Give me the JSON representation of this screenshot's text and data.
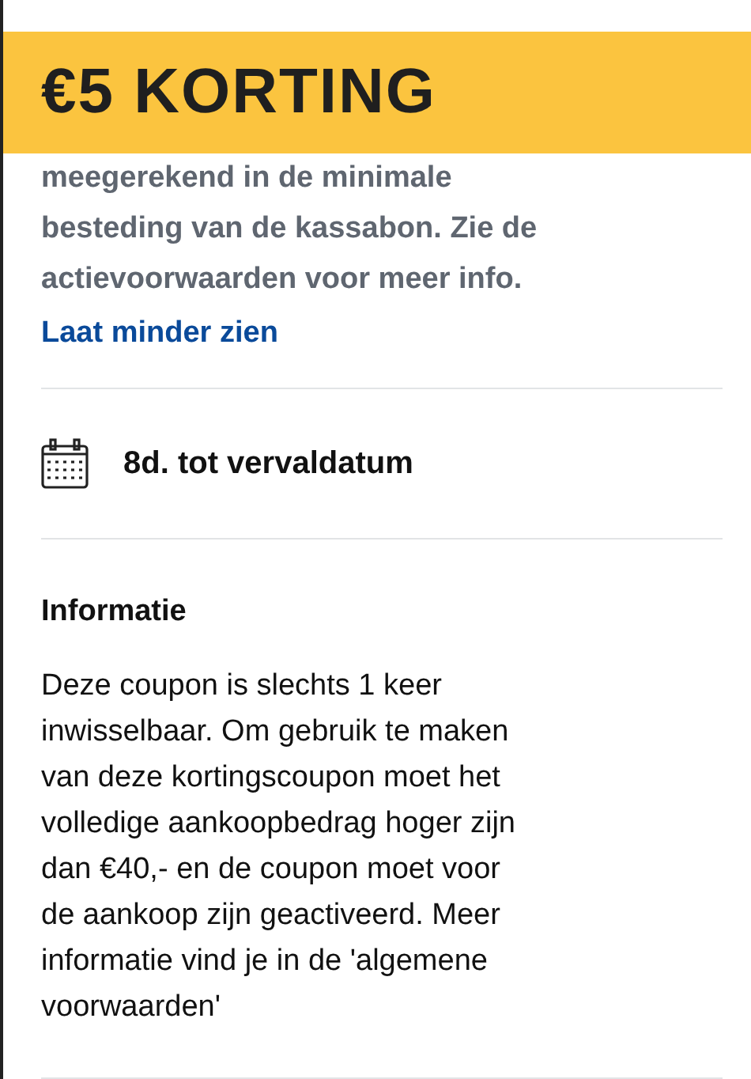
{
  "banner": {
    "title": "€5 KORTING"
  },
  "description": {
    "lines": [
      "meegerekend in de minimale",
      "besteding van de kassabon. Zie de",
      "actievoorwaarden voor meer info."
    ]
  },
  "toggle_link": "Laat minder zien",
  "expiry": {
    "text": "8d. tot vervaldatum"
  },
  "information": {
    "heading": "Informatie",
    "lines": [
      "Deze coupon is slechts 1 keer",
      "inwisselbaar. Om gebruik te maken",
      "van deze kortingscoupon moet het",
      "volledige aankoopbedrag hoger zijn",
      "dan €40,- en de coupon moet voor",
      "de aankoop zijn geactiveerd. Meer",
      "informatie vind je in de 'algemene",
      "voorwaarden'"
    ]
  }
}
